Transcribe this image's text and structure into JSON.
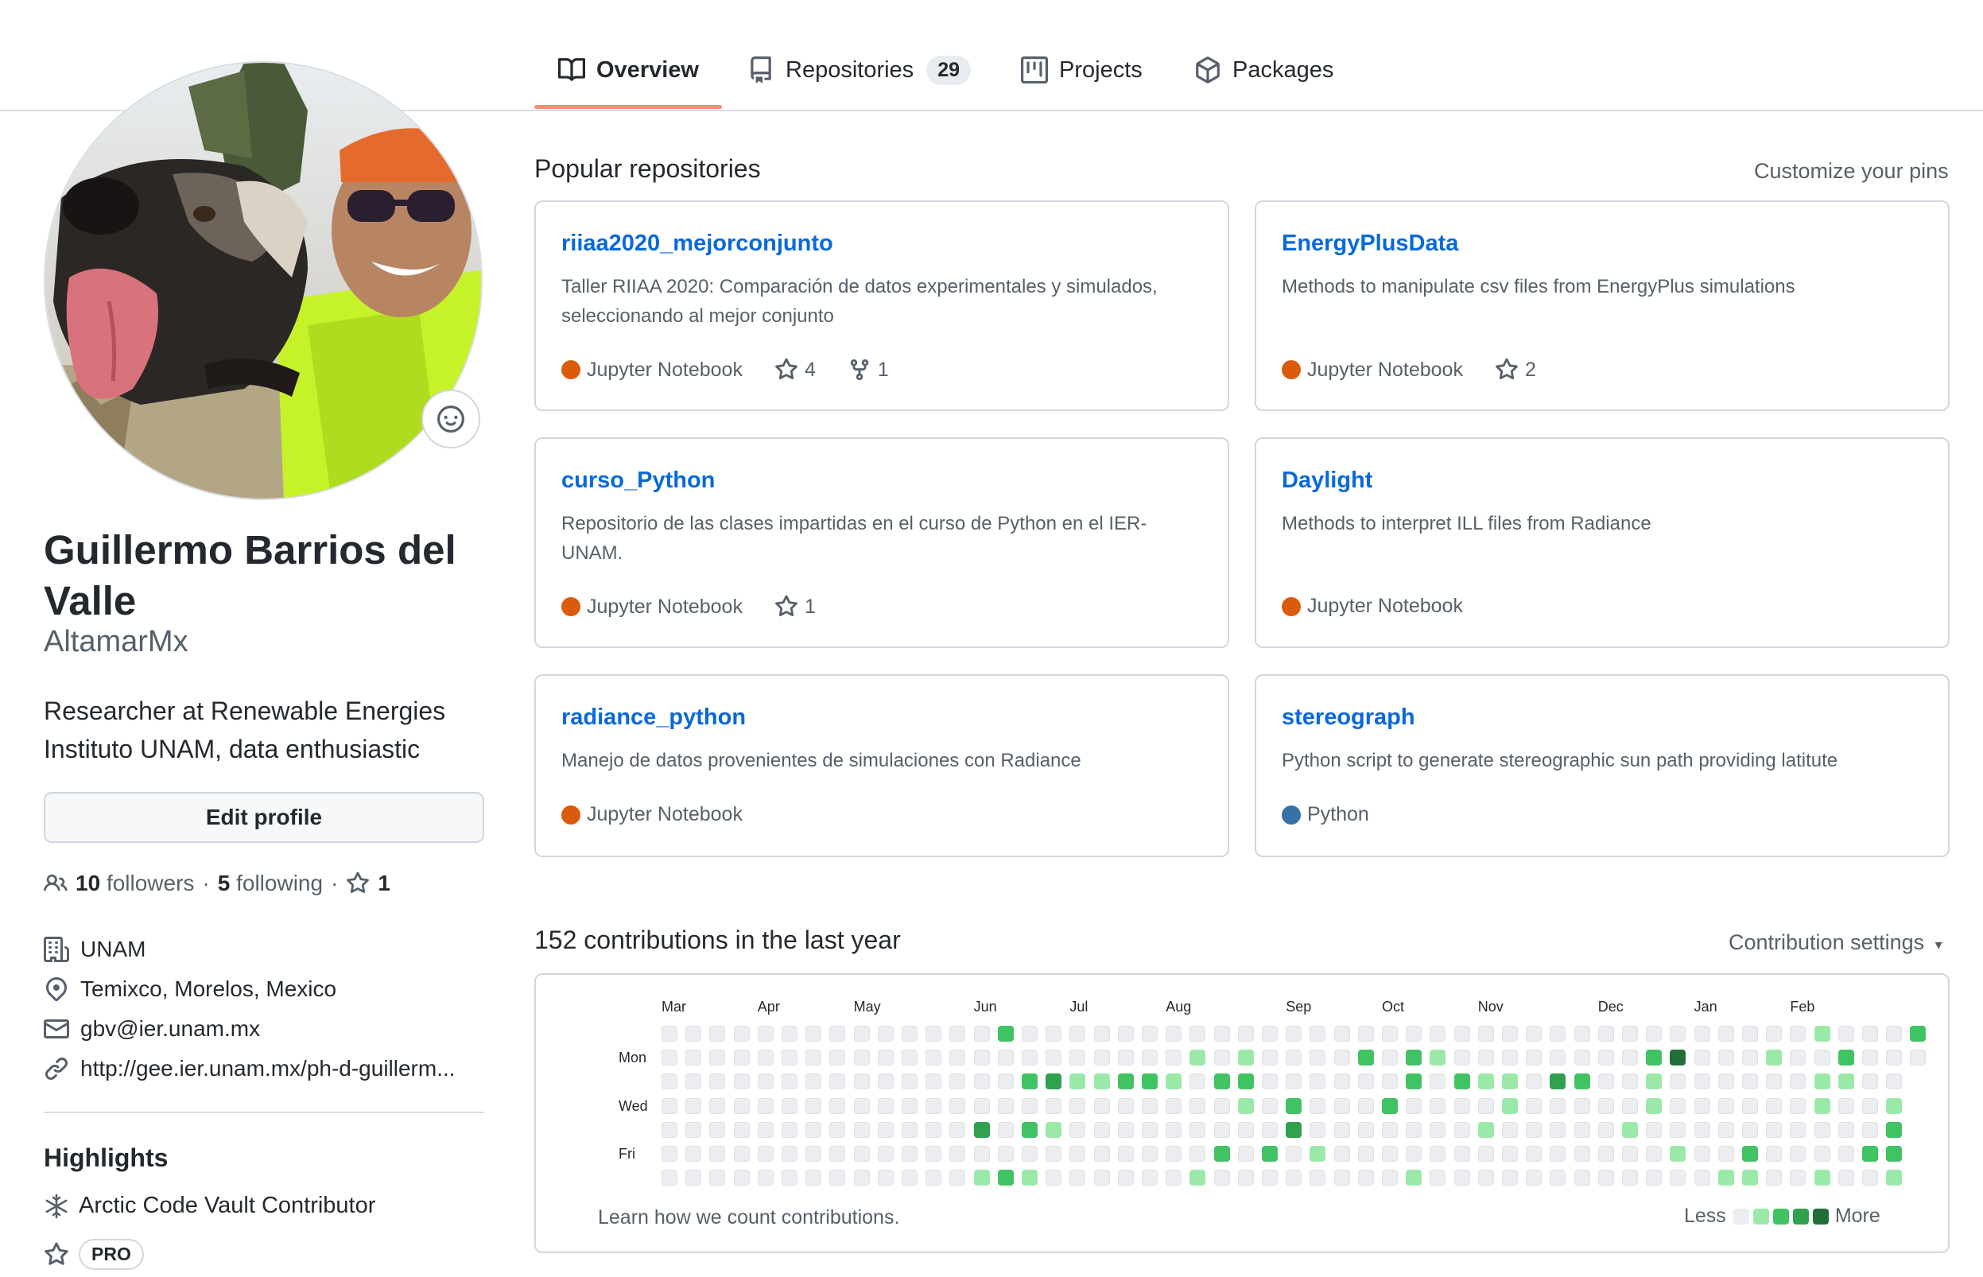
{
  "tabs": [
    {
      "label": "Overview",
      "icon": "book-icon"
    },
    {
      "label": "Repositories",
      "icon": "repo-icon",
      "count": "29"
    },
    {
      "label": "Projects",
      "icon": "project-icon"
    },
    {
      "label": "Packages",
      "icon": "package-icon"
    }
  ],
  "profile": {
    "name": "Guillermo Barrios del Valle",
    "username": "AltamarMx",
    "bio": "Researcher at Renewable Energies Instituto UNAM, data enthusiastic",
    "edit_label": "Edit profile",
    "followers_count": "10",
    "followers_label": "followers",
    "following_count": "5",
    "following_label": "following",
    "stars_count": "1",
    "sep": "·",
    "org": "UNAM",
    "location": "Temixco, Morelos, Mexico",
    "email": "gbv@ier.unam.mx",
    "website": "http://gee.ier.unam.mx/ph-d-guillerm..."
  },
  "highlights": {
    "title": "Highlights",
    "arctic": "Arctic Code Vault Contributor",
    "pro": "PRO"
  },
  "popular": {
    "title": "Popular repositories",
    "customize": "Customize your pins",
    "repos": [
      {
        "name": "riiaa2020_mejorconjunto",
        "desc": "Taller RIIAA 2020: Comparación de datos experimentales y simulados, seleccionando al mejor conjunto",
        "lang": "Jupyter Notebook",
        "lang_color": "#DA5B0B",
        "stars": "4",
        "forks": "1"
      },
      {
        "name": "EnergyPlusData",
        "desc": "Methods to manipulate csv files from EnergyPlus simulations",
        "lang": "Jupyter Notebook",
        "lang_color": "#DA5B0B",
        "stars": "2"
      },
      {
        "name": "curso_Python",
        "desc": "Repositorio de las clases impartidas en el curso de Python en el IER-UNAM.",
        "lang": "Jupyter Notebook",
        "lang_color": "#DA5B0B",
        "stars": "1"
      },
      {
        "name": "Daylight",
        "desc": "Methods to interpret ILL files from Radiance",
        "lang": "Jupyter Notebook",
        "lang_color": "#DA5B0B"
      },
      {
        "name": "radiance_python",
        "desc": "Manejo de datos provenientes de simulaciones con Radiance",
        "lang": "Jupyter Notebook",
        "lang_color": "#DA5B0B"
      },
      {
        "name": "stereograph",
        "desc": "Python script to generate stereographic sun path providing latitute",
        "lang": "Python",
        "lang_color": "#3572A5"
      }
    ]
  },
  "contributions": {
    "title": "152 contributions in the last year",
    "settings": "Contribution settings",
    "months": [
      {
        "label": "Mar",
        "week": 0
      },
      {
        "label": "Apr",
        "week": 4
      },
      {
        "label": "May",
        "week": 8
      },
      {
        "label": "Jun",
        "week": 13
      },
      {
        "label": "Jul",
        "week": 17
      },
      {
        "label": "Aug",
        "week": 21
      },
      {
        "label": "Sep",
        "week": 26
      },
      {
        "label": "Oct",
        "week": 30
      },
      {
        "label": "Nov",
        "week": 34
      },
      {
        "label": "Dec",
        "week": 39
      },
      {
        "label": "Jan",
        "week": 43
      },
      {
        "label": "Feb",
        "week": 47
      }
    ],
    "days": [
      {
        "label": "Mon",
        "row": 1
      },
      {
        "label": "Wed",
        "row": 3
      },
      {
        "label": "Fri",
        "row": 5
      }
    ],
    "levels": [
      "#ebedf0",
      "#9be9a8",
      "#40c463",
      "#30a14e",
      "#216e39"
    ],
    "weeks": 53,
    "last_week_days": 2,
    "active_cells": [
      [
        14,
        0,
        2
      ],
      [
        13,
        6,
        1
      ],
      [
        14,
        6,
        2
      ],
      [
        15,
        6,
        1
      ],
      [
        15,
        2,
        2
      ],
      [
        16,
        2,
        3
      ],
      [
        17,
        2,
        1
      ],
      [
        18,
        2,
        1
      ],
      [
        19,
        2,
        2
      ],
      [
        20,
        2,
        2
      ],
      [
        21,
        2,
        1
      ],
      [
        23,
        2,
        2
      ],
      [
        24,
        2,
        2
      ],
      [
        13,
        4,
        3
      ],
      [
        15,
        4,
        2
      ],
      [
        16,
        4,
        1
      ],
      [
        22,
        1,
        1
      ],
      [
        24,
        1,
        1
      ],
      [
        23,
        5,
        2
      ],
      [
        22,
        6,
        1
      ],
      [
        24,
        3,
        1
      ],
      [
        26,
        3,
        2
      ],
      [
        26,
        4,
        3
      ],
      [
        25,
        5,
        2
      ],
      [
        27,
        5,
        1
      ],
      [
        29,
        1,
        2
      ],
      [
        31,
        1,
        2
      ],
      [
        32,
        1,
        1
      ],
      [
        31,
        2,
        2
      ],
      [
        30,
        3,
        2
      ],
      [
        31,
        6,
        1
      ],
      [
        33,
        2,
        2
      ],
      [
        34,
        2,
        1
      ],
      [
        35,
        2,
        1
      ],
      [
        37,
        2,
        3
      ],
      [
        38,
        2,
        2
      ],
      [
        34,
        4,
        1
      ],
      [
        35,
        3,
        1
      ],
      [
        41,
        1,
        2
      ],
      [
        42,
        1,
        4
      ],
      [
        41,
        2,
        1
      ],
      [
        41,
        3,
        1
      ],
      [
        40,
        4,
        1
      ],
      [
        42,
        5,
        1
      ],
      [
        44,
        6,
        1
      ],
      [
        45,
        5,
        2
      ],
      [
        45,
        6,
        1
      ],
      [
        46,
        1,
        1
      ],
      [
        48,
        0,
        1
      ],
      [
        49,
        1,
        2
      ],
      [
        48,
        2,
        1
      ],
      [
        49,
        2,
        1
      ],
      [
        48,
        3,
        1
      ],
      [
        48,
        6,
        1
      ],
      [
        50,
        5,
        2
      ],
      [
        51,
        5,
        2
      ],
      [
        51,
        4,
        2
      ],
      [
        51,
        3,
        1
      ],
      [
        51,
        6,
        1
      ],
      [
        52,
        0,
        2
      ]
    ],
    "learn_link": "Learn how we count contributions.",
    "legend_less": "Less",
    "legend_more": "More"
  }
}
